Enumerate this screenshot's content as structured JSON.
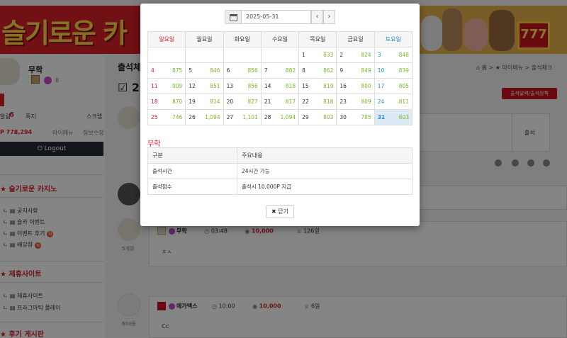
{
  "background": {
    "banner_logo": "슬기로운 카",
    "banner_slot": "777",
    "user": {
      "name": "무학",
      "gem_count": "8"
    },
    "stats": {
      "row1": {
        "a_label": "쪽지",
        "a_value": "6",
        "a_prefix": "알림",
        "b_label": "쪽지",
        "c_label": "스크랩"
      },
      "row2": {
        "points": "P 778,294",
        "mypage": "마이메뉴",
        "edit": "정보수정"
      }
    },
    "logout_label": "Logout",
    "sections": [
      {
        "title": "슬기로운 카지노",
        "items": [
          "공지사항",
          "슬카 이벤트",
          "이벤트 후기",
          "배당향"
        ]
      },
      {
        "title": "제휴사이트",
        "items": [
          "제휴사이트",
          "프라그마틱 플레이"
        ]
      },
      {
        "title": "후기 게시판"
      }
    ],
    "badge_n": "N",
    "main_title": "출석체",
    "main_title_2": "20",
    "breadcrumb": "⌂ 홈 > ★ 마이메뉴 > 출석체크",
    "red_button": "출석달력/출석정책",
    "attend_label": "출석",
    "posts": [
      {
        "name": "무학",
        "time": "03:48",
        "points": "10,000",
        "rank": "126일",
        "body": "ㅊㅅ",
        "count": "5개월"
      },
      {
        "name": "메가맥스",
        "time": "10:00",
        "points": "10,000",
        "rank": "6일",
        "body": "Cc",
        "count": "603등"
      }
    ]
  },
  "modal": {
    "date_value": "2025-05-31",
    "prev_label": "‹",
    "next_label": "›",
    "weekdays": [
      "일요일",
      "월요일",
      "화요일",
      "수요일",
      "목요일",
      "금요일",
      "토요일"
    ],
    "weeks": [
      [
        {
          "d": "",
          "v": ""
        },
        {
          "d": "",
          "v": ""
        },
        {
          "d": "",
          "v": ""
        },
        {
          "d": "",
          "v": ""
        },
        {
          "d": "1",
          "v": "833"
        },
        {
          "d": "2",
          "v": "824"
        },
        {
          "d": "3",
          "v": "848"
        }
      ],
      [
        {
          "d": "4",
          "v": "875"
        },
        {
          "d": "5",
          "v": "846"
        },
        {
          "d": "6",
          "v": "856"
        },
        {
          "d": "7",
          "v": "882"
        },
        {
          "d": "8",
          "v": "862"
        },
        {
          "d": "9",
          "v": "849"
        },
        {
          "d": "10",
          "v": "839"
        }
      ],
      [
        {
          "d": "11",
          "v": "909"
        },
        {
          "d": "12",
          "v": "851"
        },
        {
          "d": "13",
          "v": "856"
        },
        {
          "d": "14",
          "v": "818"
        },
        {
          "d": "15",
          "v": "819"
        },
        {
          "d": "16",
          "v": "800"
        },
        {
          "d": "17",
          "v": "805"
        }
      ],
      [
        {
          "d": "18",
          "v": "870"
        },
        {
          "d": "19",
          "v": "814"
        },
        {
          "d": "20",
          "v": "827"
        },
        {
          "d": "21",
          "v": "817"
        },
        {
          "d": "22",
          "v": "818"
        },
        {
          "d": "23",
          "v": "809"
        },
        {
          "d": "24",
          "v": "811"
        }
      ],
      [
        {
          "d": "25",
          "v": "746"
        },
        {
          "d": "26",
          "v": "1,094"
        },
        {
          "d": "27",
          "v": "1,101"
        },
        {
          "d": "28",
          "v": "1,094"
        },
        {
          "d": "29",
          "v": "803"
        },
        {
          "d": "30",
          "v": "785"
        },
        {
          "d": "31",
          "v": "603"
        }
      ]
    ],
    "today": "31",
    "user_name": "무학",
    "info_headers": [
      "구분",
      "주요내용"
    ],
    "info_rows": [
      [
        "출석시간",
        "24시간 가능"
      ],
      [
        "출석점수",
        "출석시 10,000P 지급"
      ]
    ],
    "close_label": "✖ 닫기"
  },
  "colors": {
    "accent": "#d8202a",
    "sat": "#2a8ad0",
    "points_green": "#7ab82c",
    "today_bg": "#dde9f5"
  }
}
